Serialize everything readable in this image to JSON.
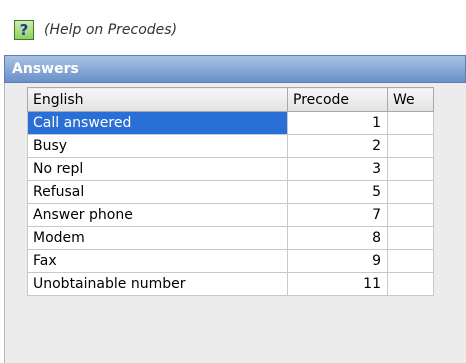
{
  "help": {
    "icon": "help-question-icon",
    "link_text": "(Help on Precodes)"
  },
  "panel": {
    "title": "Answers"
  },
  "table": {
    "headers": {
      "english": "English",
      "precode": "Precode",
      "weight": "We"
    },
    "rows": [
      {
        "english": "Call answered",
        "precode": "1",
        "selected": true
      },
      {
        "english": "Busy",
        "precode": "2"
      },
      {
        "english": "No repl",
        "precode": "3"
      },
      {
        "english": "Refusal",
        "precode": "5"
      },
      {
        "english": "Answer phone",
        "precode": "7"
      },
      {
        "english": "Modem",
        "precode": "8"
      },
      {
        "english": "Fax",
        "precode": "9"
      },
      {
        "english": "Unobtainable number",
        "precode": "11"
      }
    ]
  },
  "colors": {
    "selection": "#2a6fd6",
    "header_gradient_top": "#a8c2e4",
    "header_gradient_bottom": "#6a90c8"
  }
}
